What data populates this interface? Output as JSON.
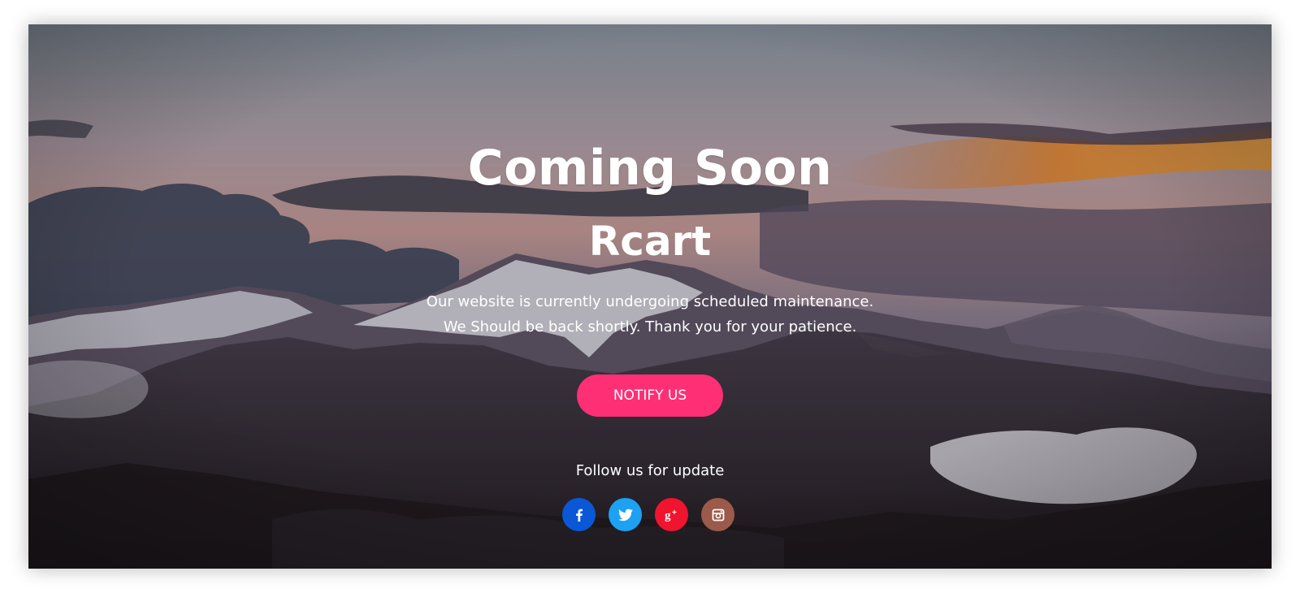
{
  "page": {
    "heading": "Coming Soon",
    "brand": "Rcart",
    "message_line1": "Our website is currently undergoing scheduled maintenance.",
    "message_line2": "We Should be back shortly. Thank you for your patience.",
    "notify_label": "NOTIFY US",
    "follow_text": "Follow us for update"
  },
  "social": [
    {
      "name": "facebook",
      "icon": "facebook-icon",
      "color": "#0a58d6"
    },
    {
      "name": "twitter",
      "icon": "twitter-icon",
      "color": "#1da1f2"
    },
    {
      "name": "google-plus",
      "icon": "google-plus-icon",
      "color": "#f0142f"
    },
    {
      "name": "instagram",
      "icon": "instagram-icon",
      "color": "#9b5a4a"
    }
  ],
  "colors": {
    "button": "#ff2f75",
    "text": "#ffffff"
  }
}
